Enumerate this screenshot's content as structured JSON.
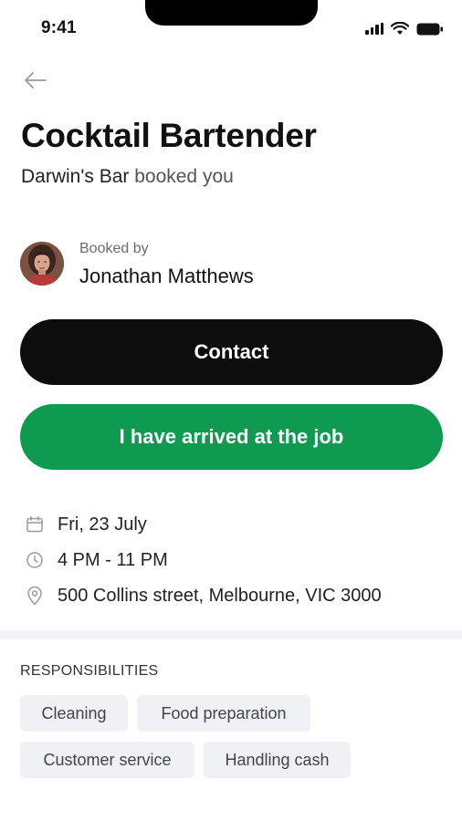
{
  "status_bar": {
    "time": "9:41",
    "icons": [
      "signal-icon",
      "wifi-icon",
      "battery-icon"
    ]
  },
  "header": {
    "back_icon": "arrow-left-icon",
    "title": "Cocktail Bartender",
    "venue": "Darwin's Bar",
    "booked_text": " booked you"
  },
  "booker": {
    "label": "Booked by",
    "name": "Jonathan Matthews",
    "avatar_icon": "avatar-photo"
  },
  "actions": {
    "contact_label": "Contact",
    "arrived_label": "I have arrived at the job"
  },
  "details": {
    "date": "Fri, 23 July",
    "time": "4 PM - 11 PM",
    "location": "500 Collins street, Melbourne, VIC 3000",
    "date_icon": "calendar-icon",
    "time_icon": "clock-icon",
    "location_icon": "location-pin-icon"
  },
  "responsibilities": {
    "title": "RESPONSIBILITIES",
    "items": [
      "Cleaning",
      "Food preparation",
      "Customer service",
      "Handling cash"
    ]
  },
  "colors": {
    "primary_dark": "#0d0d0d",
    "success_green": "#0e9a4f",
    "chip_bg": "#eff1f4"
  }
}
